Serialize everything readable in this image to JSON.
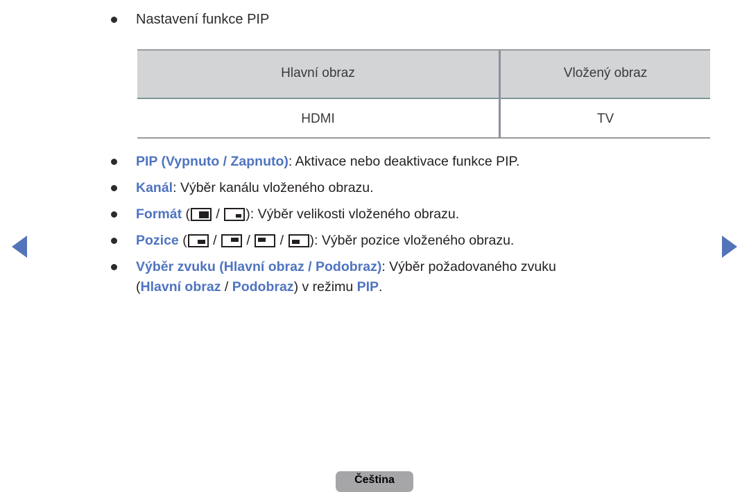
{
  "page": {
    "heading_bullet": "Nastavení funkce PIP",
    "language_button": "Čeština",
    "accent_blue": "#4f74c0",
    "nav": {
      "prev_icon": "triangle-left-icon",
      "next_icon": "triangle-right-icon"
    }
  },
  "table": {
    "headers": [
      "Hlavní obraz",
      "Vložený obraz"
    ],
    "rows": [
      [
        "HDMI",
        "TV"
      ]
    ]
  },
  "items": [
    {
      "term": "PIP (Vypnuto / Zapnuto)",
      "separator": ": ",
      "description": "Aktivace nebo deaktivace funkce PIP."
    },
    {
      "term": "Kanál",
      "separator": ": ",
      "description": "Výběr kanálu vloženého obrazu."
    },
    {
      "term": "Formát",
      "icons_open": " (",
      "icons_close": ")",
      "separator": ": ",
      "icons": [
        "pip-size-large-icon",
        "pip-size-small-icon"
      ],
      "icon_separator": " / ",
      "description": "Výběr velikosti vloženého obrazu."
    },
    {
      "term": "Pozice",
      "icons_open": " (",
      "icons_close": ")",
      "separator": ": ",
      "icons": [
        "pip-position-bottom-right-icon",
        "pip-position-top-right-icon",
        "pip-position-top-left-icon",
        "pip-position-bottom-left-icon"
      ],
      "icon_separator": " / ",
      "description": "Výběr pozice vloženého obrazu."
    },
    {
      "term": "Výběr zvuku (Hlavní obraz / Podobraz)",
      "separator": ": ",
      "description": "Výběr požadovaného zvuku",
      "line2": {
        "open_paren": "(",
        "term_a": "Hlavní obraz",
        "slash": " / ",
        "term_b": "Podobraz",
        "close_paren": ")",
        "middle": " v režimu ",
        "term_c": "PIP",
        "period": "."
      }
    }
  ]
}
